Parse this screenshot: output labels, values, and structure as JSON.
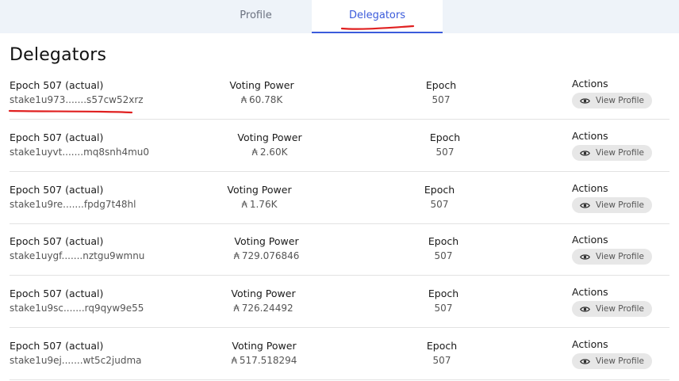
{
  "tabs": [
    {
      "label": "Profile",
      "active": false
    },
    {
      "label": "Delegators",
      "active": true
    }
  ],
  "page_title": "Delegators",
  "columns": {
    "voting_power": "Voting Power",
    "epoch": "Epoch",
    "actions": "Actions"
  },
  "ada_symbol": "₳",
  "view_profile_label": "View Profile",
  "delegators": [
    {
      "epoch_label": "Epoch 507 (actual)",
      "address": "stake1u973.......s57cw52xrz",
      "voting_power": "60.78K",
      "epoch": "507"
    },
    {
      "epoch_label": "Epoch 507 (actual)",
      "address": "stake1uyvt.......mq8snh4mu0",
      "voting_power": "2.60K",
      "epoch": "507"
    },
    {
      "epoch_label": "Epoch 507 (actual)",
      "address": "stake1u9re.......fpdg7t48hl",
      "voting_power": "1.76K",
      "epoch": "507"
    },
    {
      "epoch_label": "Epoch 507 (actual)",
      "address": "stake1uygf.......nztgu9wmnu",
      "voting_power": "729.076846",
      "epoch": "507"
    },
    {
      "epoch_label": "Epoch 507 (actual)",
      "address": "stake1u9sc.......rq9qyw9e55",
      "voting_power": "726.24492",
      "epoch": "507"
    },
    {
      "epoch_label": "Epoch 507 (actual)",
      "address": "stake1u9ej.......wt5c2judma",
      "voting_power": "517.518294",
      "epoch": "507"
    }
  ],
  "colors": {
    "accent": "#3b5bdb",
    "tabbar_bg": "#eef3f9",
    "annotation_red": "#e02020",
    "button_bg": "#e7e7e7"
  }
}
